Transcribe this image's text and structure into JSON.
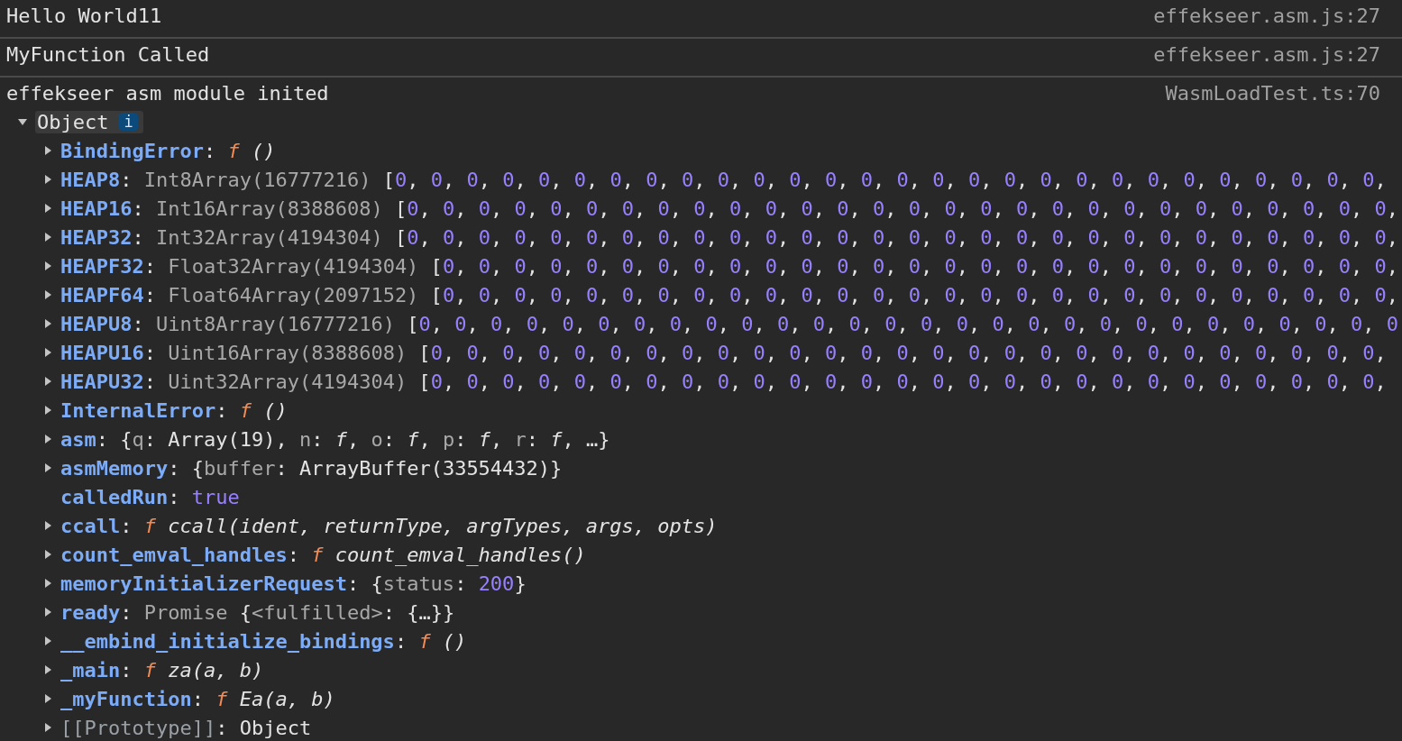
{
  "messages": [
    {
      "text": "Hello World11",
      "source": "effekseer.asm.js:27"
    },
    {
      "text": "MyFunction Called",
      "source": "effekseer.asm.js:27"
    },
    {
      "text": "effekseer asm module inited",
      "source": "WasmLoadTest.ts:70",
      "object": {
        "label": "Object",
        "badge": "i",
        "expanded": true,
        "properties": [
          {
            "key": "BindingError",
            "kind": "own",
            "expandable": true,
            "tokens": [
              {
                "kind": "plain",
                "text": ": "
              },
              {
                "kind": "func",
                "text": "f"
              },
              {
                "kind": "italic",
                "text": " ()"
              }
            ]
          },
          {
            "key": "HEAP8",
            "kind": "own",
            "expandable": true,
            "tokens": [
              {
                "kind": "plain",
                "text": ": "
              },
              {
                "kind": "dim",
                "text": "Int8Array(16777216)"
              },
              {
                "kind": "array",
                "text": " [0, 0, 0, 0, 0, 0, 0, 0, 0, 0, 0, 0, 0, 0, 0, 0, 0, 0, 0, 0, 0, 0, 0, 0, 0, 0, 0, 0,"
              }
            ]
          },
          {
            "key": "HEAP16",
            "kind": "own",
            "expandable": true,
            "tokens": [
              {
                "kind": "plain",
                "text": ": "
              },
              {
                "kind": "dim",
                "text": "Int16Array(8388608)"
              },
              {
                "kind": "array",
                "text": " [0, 0, 0, 0, 0, 0, 0, 0, 0, 0, 0, 0, 0, 0, 0, 0, 0, 0, 0, 0, 0, 0, 0, 0, 0, 0, 0, 0,"
              }
            ]
          },
          {
            "key": "HEAP32",
            "kind": "own",
            "expandable": true,
            "tokens": [
              {
                "kind": "plain",
                "text": ": "
              },
              {
                "kind": "dim",
                "text": "Int32Array(4194304)"
              },
              {
                "kind": "array",
                "text": " [0, 0, 0, 0, 0, 0, 0, 0, 0, 0, 0, 0, 0, 0, 0, 0, 0, 0, 0, 0, 0, 0, 0, 0, 0, 0, 0, 0,"
              }
            ]
          },
          {
            "key": "HEAPF32",
            "kind": "own",
            "expandable": true,
            "tokens": [
              {
                "kind": "plain",
                "text": ": "
              },
              {
                "kind": "dim",
                "text": "Float32Array(4194304)"
              },
              {
                "kind": "array",
                "text": " [0, 0, 0, 0, 0, 0, 0, 0, 0, 0, 0, 0, 0, 0, 0, 0, 0, 0, 0, 0, 0, 0, 0, 0, 0, 0, 0,"
              }
            ]
          },
          {
            "key": "HEAPF64",
            "kind": "own",
            "expandable": true,
            "tokens": [
              {
                "kind": "plain",
                "text": ": "
              },
              {
                "kind": "dim",
                "text": "Float64Array(2097152)"
              },
              {
                "kind": "array",
                "text": " [0, 0, 0, 0, 0, 0, 0, 0, 0, 0, 0, 0, 0, 0, 0, 0, 0, 0, 0, 0, 0, 0, 0, 0, 0, 0, 0,"
              }
            ]
          },
          {
            "key": "HEAPU8",
            "kind": "own",
            "expandable": true,
            "tokens": [
              {
                "kind": "plain",
                "text": ": "
              },
              {
                "kind": "dim",
                "text": "Uint8Array(16777216)"
              },
              {
                "kind": "array",
                "text": " [0, 0, 0, 0, 0, 0, 0, 0, 0, 0, 0, 0, 0, 0, 0, 0, 0, 0, 0, 0, 0, 0, 0, 0, 0, 0, 0, 0"
              }
            ]
          },
          {
            "key": "HEAPU16",
            "kind": "own",
            "expandable": true,
            "tokens": [
              {
                "kind": "plain",
                "text": ": "
              },
              {
                "kind": "dim",
                "text": "Uint16Array(8388608)"
              },
              {
                "kind": "array",
                "text": " [0, 0, 0, 0, 0, 0, 0, 0, 0, 0, 0, 0, 0, 0, 0, 0, 0, 0, 0, 0, 0, 0, 0, 0, 0, 0, 0,"
              }
            ]
          },
          {
            "key": "HEAPU32",
            "kind": "own",
            "expandable": true,
            "tokens": [
              {
                "kind": "plain",
                "text": ": "
              },
              {
                "kind": "dim",
                "text": "Uint32Array(4194304)"
              },
              {
                "kind": "array",
                "text": " [0, 0, 0, 0, 0, 0, 0, 0, 0, 0, 0, 0, 0, 0, 0, 0, 0, 0, 0, 0, 0, 0, 0, 0, 0, 0, 0,"
              }
            ]
          },
          {
            "key": "InternalError",
            "kind": "own",
            "expandable": true,
            "tokens": [
              {
                "kind": "plain",
                "text": ": "
              },
              {
                "kind": "func",
                "text": "f"
              },
              {
                "kind": "italic",
                "text": " ()"
              }
            ]
          },
          {
            "key": "asm",
            "kind": "own",
            "expandable": true,
            "tokens": [
              {
                "kind": "plain",
                "text": ": {"
              },
              {
                "kind": "dim",
                "text": "q"
              },
              {
                "kind": "plain",
                "text": ": Array(19), "
              },
              {
                "kind": "dim",
                "text": "n"
              },
              {
                "kind": "plain",
                "text": ": "
              },
              {
                "kind": "italic",
                "text": "f"
              },
              {
                "kind": "plain",
                "text": ", "
              },
              {
                "kind": "dim",
                "text": "o"
              },
              {
                "kind": "plain",
                "text": ": "
              },
              {
                "kind": "italic",
                "text": "f"
              },
              {
                "kind": "plain",
                "text": ", "
              },
              {
                "kind": "dim",
                "text": "p"
              },
              {
                "kind": "plain",
                "text": ": "
              },
              {
                "kind": "italic",
                "text": "f"
              },
              {
                "kind": "plain",
                "text": ", "
              },
              {
                "kind": "dim",
                "text": "r"
              },
              {
                "kind": "plain",
                "text": ": "
              },
              {
                "kind": "italic",
                "text": "f"
              },
              {
                "kind": "plain",
                "text": ", …}"
              }
            ]
          },
          {
            "key": "asmMemory",
            "kind": "own",
            "expandable": true,
            "tokens": [
              {
                "kind": "plain",
                "text": ": {"
              },
              {
                "kind": "dim",
                "text": "buffer"
              },
              {
                "kind": "plain",
                "text": ": ArrayBuffer(33554432)}"
              }
            ]
          },
          {
            "key": "calledRun",
            "kind": "own",
            "expandable": false,
            "tokens": [
              {
                "kind": "plain",
                "text": ": "
              },
              {
                "kind": "number",
                "text": "true"
              }
            ]
          },
          {
            "key": "ccall",
            "kind": "own",
            "expandable": true,
            "tokens": [
              {
                "kind": "plain",
                "text": ": "
              },
              {
                "kind": "func",
                "text": "f"
              },
              {
                "kind": "italic",
                "text": " ccall(ident, returnType, argTypes, args, opts)"
              }
            ]
          },
          {
            "key": "count_emval_handles",
            "kind": "own",
            "expandable": true,
            "tokens": [
              {
                "kind": "plain",
                "text": ": "
              },
              {
                "kind": "func",
                "text": "f"
              },
              {
                "kind": "italic",
                "text": " count_emval_handles()"
              }
            ]
          },
          {
            "key": "memoryInitializerRequest",
            "kind": "own",
            "expandable": true,
            "tokens": [
              {
                "kind": "plain",
                "text": ": {"
              },
              {
                "kind": "dim",
                "text": "status"
              },
              {
                "kind": "plain",
                "text": ": "
              },
              {
                "kind": "number",
                "text": "200"
              },
              {
                "kind": "plain",
                "text": "}"
              }
            ]
          },
          {
            "key": "ready",
            "kind": "own",
            "expandable": true,
            "tokens": [
              {
                "kind": "plain",
                "text": ": "
              },
              {
                "kind": "dim",
                "text": "Promise"
              },
              {
                "kind": "plain",
                "text": " {"
              },
              {
                "kind": "dim",
                "text": "<fulfilled>"
              },
              {
                "kind": "plain",
                "text": ": {…}}"
              }
            ]
          },
          {
            "key": "__embind_initialize_bindings",
            "kind": "own",
            "expandable": true,
            "tokens": [
              {
                "kind": "plain",
                "text": ": "
              },
              {
                "kind": "func",
                "text": "f"
              },
              {
                "kind": "italic",
                "text": " ()"
              }
            ]
          },
          {
            "key": "_main",
            "kind": "own",
            "expandable": true,
            "tokens": [
              {
                "kind": "plain",
                "text": ": "
              },
              {
                "kind": "func",
                "text": "f"
              },
              {
                "kind": "italic",
                "text": " za(a, b)"
              }
            ]
          },
          {
            "key": "_myFunction",
            "kind": "own",
            "expandable": true,
            "tokens": [
              {
                "kind": "plain",
                "text": ": "
              },
              {
                "kind": "func",
                "text": "f"
              },
              {
                "kind": "italic",
                "text": " Ea(a, b)"
              }
            ]
          },
          {
            "key": "[[Prototype]]",
            "kind": "internal",
            "expandable": true,
            "tokens": [
              {
                "kind": "plain",
                "text": ": Object"
              }
            ]
          }
        ]
      }
    }
  ]
}
